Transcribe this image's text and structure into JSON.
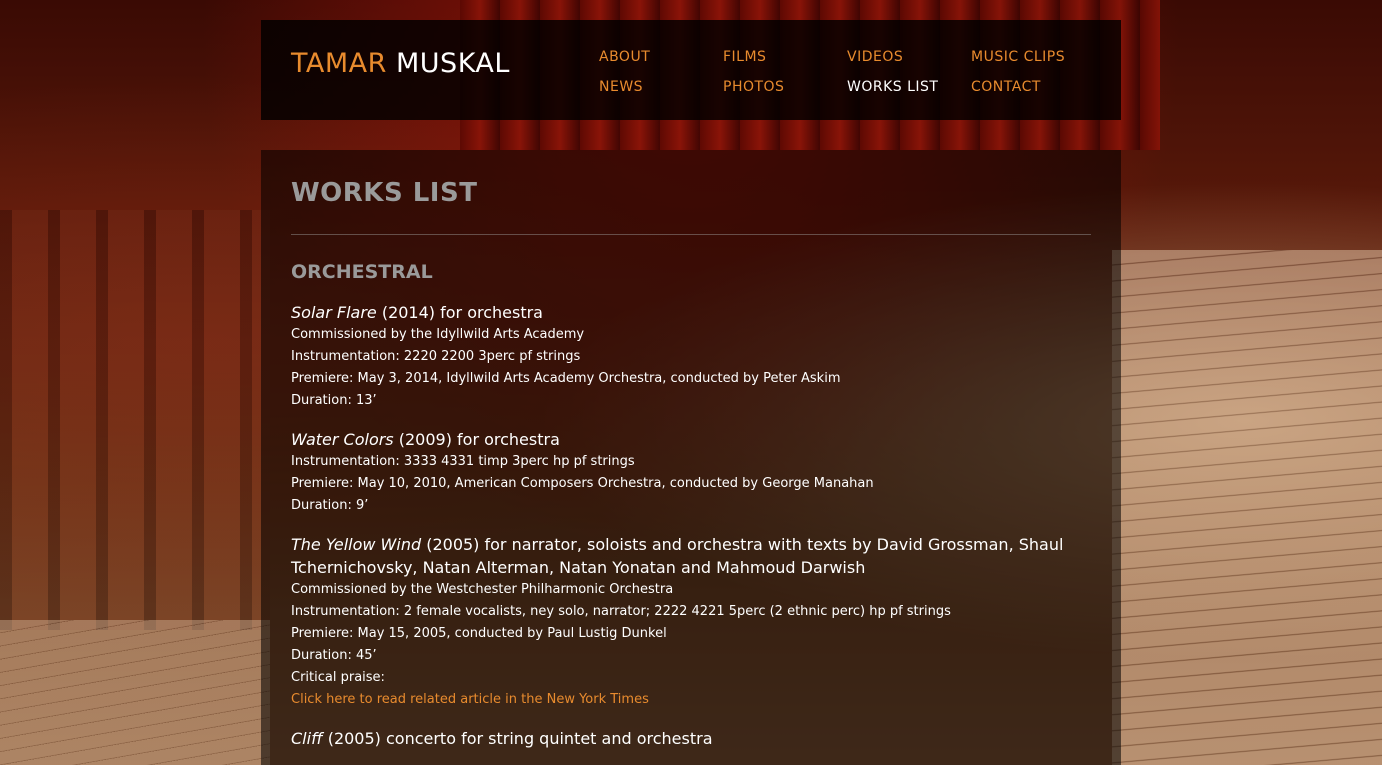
{
  "site": {
    "logo_first": "TAMAR",
    "logo_last": "MUSKAL"
  },
  "nav": {
    "items": [
      {
        "label": "ABOUT"
      },
      {
        "label": "FILMS"
      },
      {
        "label": "VIDEOS"
      },
      {
        "label": "MUSIC CLIPS"
      },
      {
        "label": "NEWS"
      },
      {
        "label": "PHOTOS"
      },
      {
        "label": "WORKS LIST"
      },
      {
        "label": "CONTACT"
      }
    ]
  },
  "page": {
    "title": "WORKS LIST",
    "section": "ORCHESTRAL"
  },
  "works": [
    {
      "title": "Solar Flare",
      "rest": " (2014) for orchestra",
      "lines": [
        "Commissioned by the Idyllwild Arts Academy",
        "Instrumentation: 2220 2200 3perc pf strings",
        "Premiere: May 3, 2014, Idyllwild Arts Academy Orchestra, conducted by Peter Askim",
        "Duration: 13’"
      ]
    },
    {
      "title": "Water Colors",
      "rest": " (2009) for orchestra",
      "lines": [
        "Instrumentation: 3333 4331 timp 3perc hp pf strings",
        "Premiere: May 10, 2010, American Composers Orchestra, conducted by George Manahan",
        "Duration: 9’"
      ]
    },
    {
      "title": "The Yellow Wind",
      "rest": " (2005) for narrator, soloists and orchestra with texts by David Grossman, Shaul Tchernichovsky, Natan Alterman, Natan Yonatan and Mahmoud Darwish",
      "lines": [
        "Commissioned by the Westchester Philharmonic Orchestra",
        "Instrumentation: 2 female vocalists, ney solo, narrator; 2222 4221 5perc (2 ethnic perc) hp pf strings",
        "Premiere: May 15, 2005, conducted by Paul Lustig Dunkel",
        "Duration: 45’",
        "Critical praise:"
      ],
      "link": "Click here to read related article in the New York Times"
    },
    {
      "title": "Cliff",
      "rest": " (2005) concerto for string quintet and orchestra",
      "lines": []
    }
  ]
}
